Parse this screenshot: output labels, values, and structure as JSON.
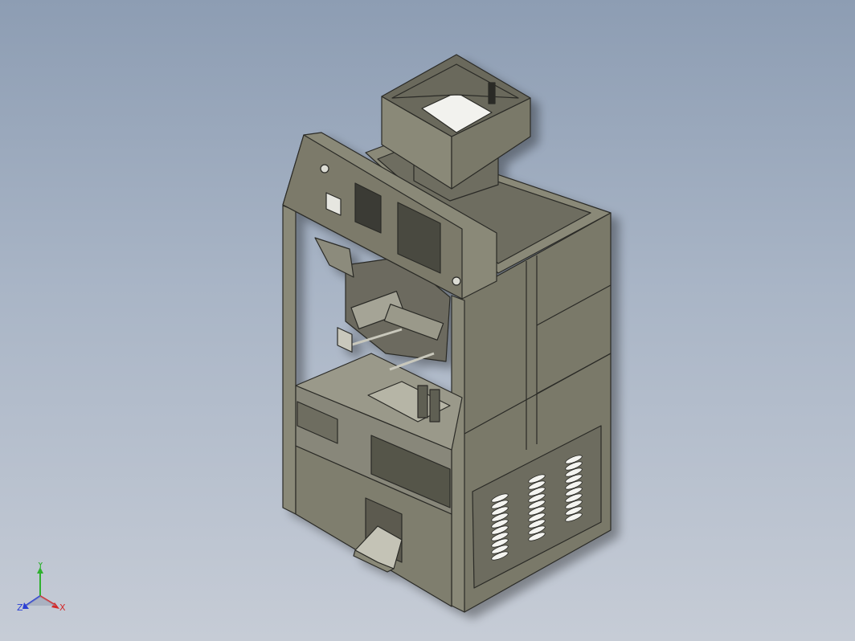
{
  "viewport": {
    "background_top": "#8d9db3",
    "background_bottom": "#c6ccd6",
    "model_color": "#7f7e6e",
    "model_dark": "#5f5e52",
    "model_light": "#9c9b8a",
    "edge_color": "#2a2a26"
  },
  "triad": {
    "x_label": "X",
    "y_label": "Y",
    "z_label": "Z",
    "x_color": "#d42a2a",
    "y_color": "#2fb02f",
    "z_color": "#2a3fd4"
  }
}
